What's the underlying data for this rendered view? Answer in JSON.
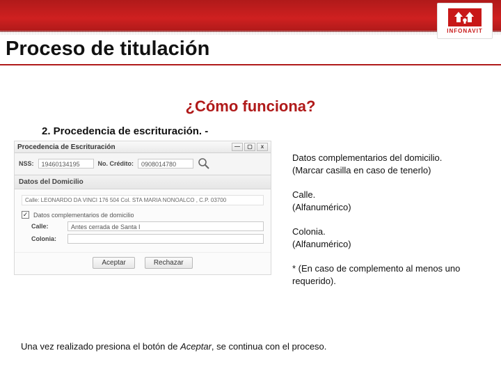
{
  "logo": {
    "name": "INFONAVIT"
  },
  "slide": {
    "title": "Proceso de titulación",
    "how": "¿Cómo funciona?",
    "step": "2. Procedencia de escrituración. -"
  },
  "dialog": {
    "title": "Procedencia de Escrituración",
    "wnd": {
      "min": "—",
      "max": "▢",
      "close": "x"
    },
    "row1": {
      "nss_lbl": "NSS:",
      "nss_val": "19460134195",
      "credito_lbl": "No. Crédito:",
      "credito_val": "0908014780"
    },
    "section_head": "Datos del Domicilio",
    "addr": "Calle: LEONARDO DA VINCI 176   504 Col. STA MARIA NONOALCO , C.P. 03700",
    "chk_label": "Datos complementarios de domicilio",
    "fields": {
      "calle_lbl": "Calle:",
      "calle_val": "Antes cerrada de Santa I",
      "colonia_lbl": "Colonia:",
      "colonia_val": ""
    },
    "buttons": {
      "accept": "Aceptar",
      "reject": "Rechazar"
    }
  },
  "desc": {
    "d1a": "Datos complementarios del domicilio.",
    "d1b": "(Marcar casilla en caso de tenerlo)",
    "d2a": "Calle.",
    "d2b": "(Alfanumérico)",
    "d3a": "Colonia.",
    "d3b": "(Alfanumérico)",
    "d4": "* (En caso de complemento al menos uno requerido)."
  },
  "footer": {
    "pre": "Una vez realizado presiona el botón de ",
    "em": "Aceptar",
    "post": ", se continua con el proceso."
  }
}
